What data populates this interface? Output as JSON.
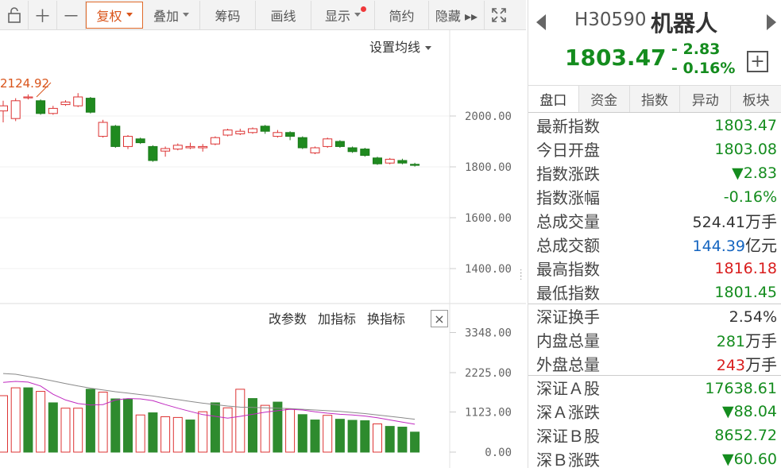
{
  "toolbar": {
    "items": [
      {
        "label": "复权",
        "active": true,
        "dropdown": true
      },
      {
        "label": "叠加",
        "dropdown": true
      },
      {
        "label": "筹码"
      },
      {
        "label": "画线"
      },
      {
        "label": "显示",
        "dropdown": true,
        "badge": true
      },
      {
        "label": "简约"
      },
      {
        "label": "隐藏 ▸▸"
      }
    ],
    "lock_icon": "lock-icon",
    "zoom_in_icon": "plus-icon",
    "zoom_out_icon": "minus-icon",
    "fullscreen_icon": "fullscreen-icon"
  },
  "main_chart": {
    "ma_setting_label": "设置均线",
    "high_marker": "2124.92",
    "y_ticks": [
      "2000.00",
      "1800.00",
      "1600.00",
      "1400.00"
    ]
  },
  "indicator": {
    "links": [
      "改参数",
      "加指标",
      "换指标"
    ],
    "close_label": "×",
    "y_ticks": [
      "3348.00",
      "2225.00",
      "1123.00",
      "0.00"
    ]
  },
  "chart_data": {
    "type": "candlestick",
    "y_ticks": [
      2000,
      1800,
      1600,
      1400
    ],
    "high_annotation": 2124.92,
    "candles": [
      {
        "o": 2020,
        "c": 2040,
        "h": 2060,
        "l": 1975
      },
      {
        "o": 1990,
        "c": 2060,
        "h": 2070,
        "l": 1980
      },
      {
        "o": 2075,
        "c": 2075,
        "h": 2085,
        "l": 2065
      },
      {
        "o": 2060,
        "c": 2010,
        "h": 2065,
        "l": 2005
      },
      {
        "o": 2010,
        "c": 2030,
        "h": 2040,
        "l": 2005
      },
      {
        "o": 2045,
        "c": 2055,
        "h": 2062,
        "l": 2040
      },
      {
        "o": 2040,
        "c": 2075,
        "h": 2090,
        "l": 2035
      },
      {
        "o": 2070,
        "c": 2015,
        "h": 2075,
        "l": 2010
      },
      {
        "o": 1920,
        "c": 1975,
        "h": 1985,
        "l": 1915
      },
      {
        "o": 1960,
        "c": 1880,
        "h": 1965,
        "l": 1875
      },
      {
        "o": 1880,
        "c": 1920,
        "h": 1925,
        "l": 1870
      },
      {
        "o": 1910,
        "c": 1895,
        "h": 1915,
        "l": 1890
      },
      {
        "o": 1880,
        "c": 1825,
        "h": 1885,
        "l": 1820
      },
      {
        "o": 1862,
        "c": 1872,
        "h": 1880,
        "l": 1840
      },
      {
        "o": 1870,
        "c": 1885,
        "h": 1892,
        "l": 1865
      },
      {
        "o": 1875,
        "c": 1880,
        "h": 1895,
        "l": 1870
      },
      {
        "o": 1875,
        "c": 1880,
        "h": 1890,
        "l": 1860
      },
      {
        "o": 1890,
        "c": 1915,
        "h": 1920,
        "l": 1885
      },
      {
        "o": 1925,
        "c": 1945,
        "h": 1950,
        "l": 1920
      },
      {
        "o": 1930,
        "c": 1940,
        "h": 1950,
        "l": 1925
      },
      {
        "o": 1935,
        "c": 1950,
        "h": 1955,
        "l": 1930
      },
      {
        "o": 1960,
        "c": 1940,
        "h": 1965,
        "l": 1930
      },
      {
        "o": 1920,
        "c": 1935,
        "h": 1945,
        "l": 1915
      },
      {
        "o": 1935,
        "c": 1920,
        "h": 1940,
        "l": 1905
      },
      {
        "o": 1915,
        "c": 1875,
        "h": 1920,
        "l": 1870
      },
      {
        "o": 1855,
        "c": 1875,
        "h": 1880,
        "l": 1850
      },
      {
        "o": 1880,
        "c": 1910,
        "h": 1915,
        "l": 1875
      },
      {
        "o": 1900,
        "c": 1880,
        "h": 1905,
        "l": 1875
      },
      {
        "o": 1875,
        "c": 1860,
        "h": 1880,
        "l": 1855
      },
      {
        "o": 1870,
        "c": 1845,
        "h": 1875,
        "l": 1840
      },
      {
        "o": 1835,
        "c": 1812,
        "h": 1840,
        "l": 1808
      },
      {
        "o": 1815,
        "c": 1830,
        "h": 1835,
        "l": 1810
      },
      {
        "o": 1825,
        "c": 1815,
        "h": 1832,
        "l": 1810
      },
      {
        "o": 1810,
        "c": 1806,
        "h": 1816,
        "l": 1801
      }
    ],
    "volume_ticks": [
      3348,
      2225,
      1123,
      0
    ],
    "volumes": [
      {
        "v": 1580,
        "up": true
      },
      {
        "v": 1800,
        "up": true
      },
      {
        "v": 1800,
        "up": false
      },
      {
        "v": 1700,
        "up": true
      },
      {
        "v": 1380,
        "up": false
      },
      {
        "v": 1230,
        "up": true
      },
      {
        "v": 1230,
        "up": true
      },
      {
        "v": 1760,
        "up": false
      },
      {
        "v": 1680,
        "up": true
      },
      {
        "v": 1490,
        "up": false
      },
      {
        "v": 1490,
        "up": false
      },
      {
        "v": 1040,
        "up": true
      },
      {
        "v": 1100,
        "up": false
      },
      {
        "v": 990,
        "up": true
      },
      {
        "v": 970,
        "up": true
      },
      {
        "v": 900,
        "up": false
      },
      {
        "v": 1130,
        "up": true
      },
      {
        "v": 1380,
        "up": false
      },
      {
        "v": 1240,
        "up": true
      },
      {
        "v": 1760,
        "up": true
      },
      {
        "v": 1500,
        "up": false
      },
      {
        "v": 1310,
        "up": true
      },
      {
        "v": 1400,
        "up": false
      },
      {
        "v": 1200,
        "up": true
      },
      {
        "v": 1050,
        "up": false
      },
      {
        "v": 900,
        "up": false
      },
      {
        "v": 1030,
        "up": true
      },
      {
        "v": 920,
        "up": false
      },
      {
        "v": 890,
        "up": false
      },
      {
        "v": 880,
        "up": false
      },
      {
        "v": 790,
        "up": true
      },
      {
        "v": 720,
        "up": false
      },
      {
        "v": 700,
        "up": false
      },
      {
        "v": 560,
        "up": false
      }
    ],
    "ma_fast": [
      1950,
      1980,
      1960,
      1850,
      1620,
      1460,
      1360,
      1320,
      1330,
      1460,
      1500,
      1490,
      1440,
      1330,
      1230,
      1140,
      1050,
      1000,
      950,
      1000,
      1060,
      1120,
      1160,
      1200,
      1180,
      1130,
      1090,
      1060,
      1040,
      1010,
      960,
      900,
      840,
      780
    ],
    "ma_slow": [
      2200,
      2180,
      2120,
      2060,
      1990,
      1920,
      1850,
      1790,
      1740,
      1690,
      1650,
      1610,
      1570,
      1520,
      1470,
      1420,
      1370,
      1330,
      1290,
      1260,
      1250,
      1240,
      1230,
      1220,
      1200,
      1180,
      1160,
      1140,
      1110,
      1080,
      1040,
      1000,
      960,
      920
    ]
  },
  "quote": {
    "code": "H30590",
    "name": "机器人",
    "price": "1803.47",
    "change": "- 2.83",
    "change_pct": "- 0.16%",
    "prev_icon": "triangle-left-icon",
    "next_icon": "triangle-right-icon",
    "add_icon": "plus-square-icon"
  },
  "tabs": [
    "盘口",
    "资金",
    "指数",
    "异动",
    "板块"
  ],
  "rows": [
    {
      "label": "最新指数",
      "value": "1803.47",
      "color": "green"
    },
    {
      "label": "今日开盘",
      "value": "1803.08",
      "color": "green"
    },
    {
      "label": "指数涨跌",
      "value": "▼2.83",
      "color": "green"
    },
    {
      "label": "指数涨幅",
      "value": "-0.16%",
      "color": "green"
    },
    {
      "label": "总成交量",
      "value": "524.41",
      "unit": "万手",
      "color": "dark"
    },
    {
      "label": "总成交额",
      "value": "144.39",
      "unit": "亿元",
      "color": "blue"
    },
    {
      "label": "最高指数",
      "value": "1816.18",
      "color": "red"
    },
    {
      "label": "最低指数",
      "value": "1801.45",
      "color": "green"
    },
    {
      "label": "深证换手",
      "value": "2.54%",
      "color": "dark",
      "sep": true
    },
    {
      "label": "内盘总量",
      "value": "281",
      "unit": "万手",
      "color": "green"
    },
    {
      "label": "外盘总量",
      "value": "243",
      "unit": "万手",
      "color": "red"
    },
    {
      "label": "深证Ａ股",
      "value": "17638.61",
      "color": "green",
      "sep": true
    },
    {
      "label": "深Ａ涨跌",
      "value": "▼88.04",
      "color": "green"
    },
    {
      "label": "深证Ｂ股",
      "value": "8652.72",
      "color": "green"
    },
    {
      "label": "深Ｂ涨跌",
      "value": "▼60.60",
      "color": "green"
    }
  ]
}
